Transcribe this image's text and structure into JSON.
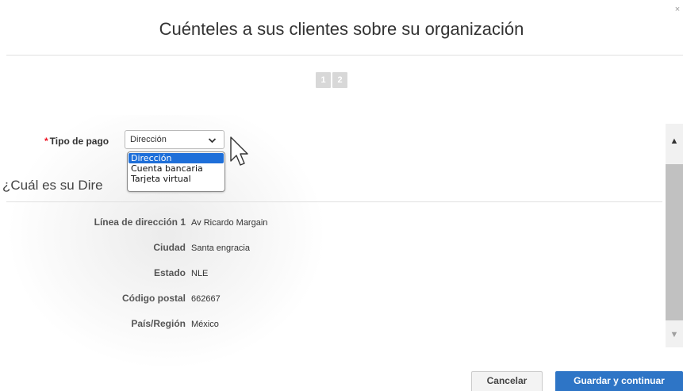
{
  "dialog": {
    "title": "Cuénteles a sus clientes sobre su organización",
    "close_glyph": "×"
  },
  "steps": [
    "1",
    "2"
  ],
  "payment": {
    "required_marker": "*",
    "label": "Tipo de pago",
    "selected_value": "Dirección",
    "chevron_icon": "chevron-down-icon",
    "options": [
      "Dirección",
      "Cuenta bancaria",
      "Tarjeta virtual"
    ]
  },
  "section": {
    "question_visible_start": "¿Cuál es su Dire",
    "question_visible_end": "?"
  },
  "address": {
    "line1": {
      "label": "Línea de dirección 1",
      "value": "Av Ricardo Margain"
    },
    "city": {
      "label": "Ciudad",
      "value": "Santa engracia"
    },
    "state": {
      "label": "Estado",
      "value": "NLE"
    },
    "postal": {
      "label": "Código postal",
      "value": "662667"
    },
    "country": {
      "label": "País/Región",
      "value": "México"
    }
  },
  "buttons": {
    "cancel": "Cancelar",
    "save": "Guardar y continuar"
  },
  "colors": {
    "primary": "#2e75c6",
    "dropdown_selected": "#1e6fd9",
    "required": "#ee1122"
  }
}
